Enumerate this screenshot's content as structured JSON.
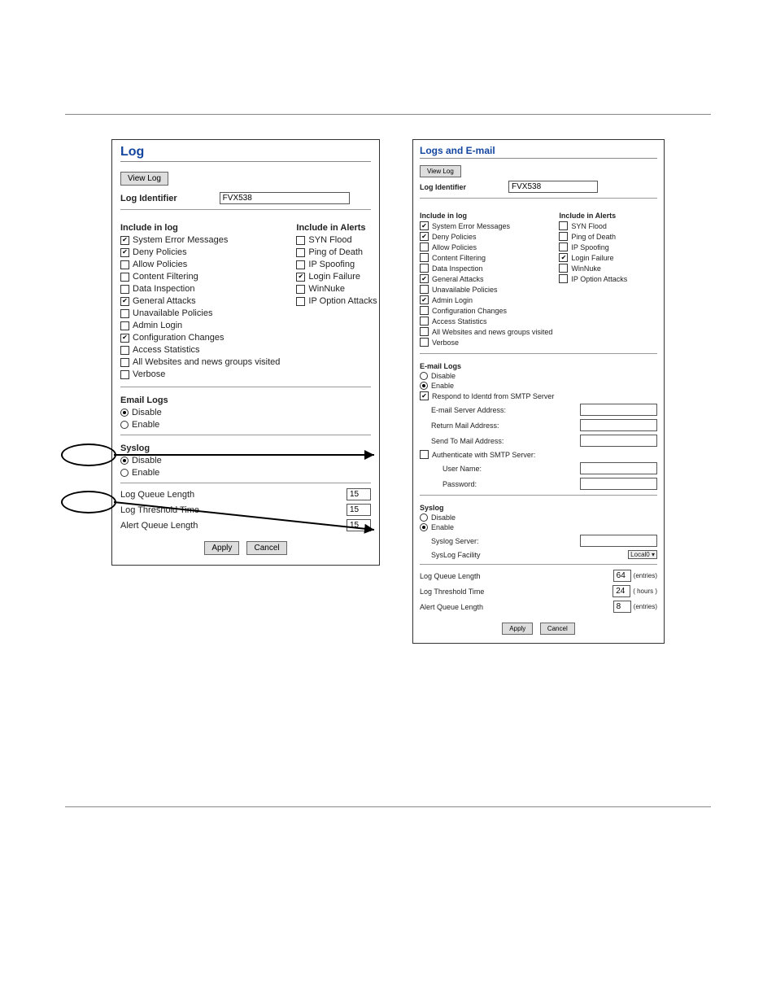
{
  "left": {
    "title": "Log",
    "view_log": "View Log",
    "log_identifier_label": "Log Identifier",
    "log_identifier_value": "FVX538",
    "include_log_hdr": "Include in log",
    "include_alerts_hdr": "Include in Alerts",
    "log_items": [
      {
        "label": "System Error Messages",
        "checked": true
      },
      {
        "label": "Deny Policies",
        "checked": true
      },
      {
        "label": "Allow Policies",
        "checked": false
      },
      {
        "label": "Content Filtering",
        "checked": false
      },
      {
        "label": "Data Inspection",
        "checked": false
      },
      {
        "label": "General Attacks",
        "checked": true
      },
      {
        "label": "Unavailable Policies",
        "checked": false
      },
      {
        "label": "Admin Login",
        "checked": false
      },
      {
        "label": "Configuration Changes",
        "checked": true
      },
      {
        "label": "Access Statistics",
        "checked": false
      },
      {
        "label": "All Websites and news groups visited",
        "checked": false
      },
      {
        "label": "Verbose",
        "checked": false
      }
    ],
    "alert_items": [
      {
        "label": "SYN Flood",
        "checked": false
      },
      {
        "label": "Ping of Death",
        "checked": false
      },
      {
        "label": "IP Spoofing",
        "checked": false
      },
      {
        "label": "Login Failure",
        "checked": true
      },
      {
        "label": "WinNuke",
        "checked": false
      },
      {
        "label": "IP Option Attacks",
        "checked": false
      }
    ],
    "email_logs_hdr": "Email Logs",
    "disable": "Disable",
    "enable": "Enable",
    "syslog_hdr": "Syslog",
    "lql_label": "Log Queue Length",
    "lql_val": "15",
    "ltt_label": "Log Threshold Time",
    "ltt_val": "15",
    "aql_label": "Alert Queue Length",
    "aql_val": "15",
    "apply": "Apply",
    "cancel": "Cancel"
  },
  "right": {
    "title": "Logs and E-mail",
    "view_log": "View Log",
    "log_identifier_label": "Log Identifier",
    "log_identifier_value": "FVX538",
    "include_log_hdr": "Include in log",
    "include_alerts_hdr": "Include in Alerts",
    "log_items": [
      {
        "label": "System Error Messages",
        "checked": true
      },
      {
        "label": "Deny Policies",
        "checked": true
      },
      {
        "label": "Allow Policies",
        "checked": false
      },
      {
        "label": "Content Filtering",
        "checked": false
      },
      {
        "label": "Data Inspection",
        "checked": false
      },
      {
        "label": "General Attacks",
        "checked": true
      },
      {
        "label": "Unavailable Policies",
        "checked": false
      },
      {
        "label": "Admin Login",
        "checked": true
      },
      {
        "label": "Configuration Changes",
        "checked": false
      },
      {
        "label": "Access Statistics",
        "checked": false
      },
      {
        "label": "All Websites and news groups visited",
        "checked": false
      },
      {
        "label": "Verbose",
        "checked": false
      }
    ],
    "alert_items": [
      {
        "label": "SYN Flood",
        "checked": false
      },
      {
        "label": "Ping of Death",
        "checked": false
      },
      {
        "label": "IP Spoofing",
        "checked": false
      },
      {
        "label": "Login Failure",
        "checked": true
      },
      {
        "label": "WinNuke",
        "checked": false
      },
      {
        "label": "IP Option Attacks",
        "checked": false
      }
    ],
    "email_logs_hdr": "E-mail Logs",
    "disable": "Disable",
    "enable": "Enable",
    "respond_identd": "Respond to Identd from SMTP Server",
    "email_server_addr": "E-mail Server Address:",
    "return_mail_addr": "Return Mail Address:",
    "send_to_mail": "Send To Mail Address:",
    "auth_smtp": "Authenticate with SMTP Server:",
    "user_name": "User Name:",
    "password": "Password:",
    "syslog_hdr": "Syslog",
    "syslog_server": "Syslog Server:",
    "syslog_facility": "SysLog Facility",
    "syslog_facility_val": "Local0",
    "lql_label": "Log Queue Length",
    "lql_val": "64",
    "lql_suffix": "(entries)",
    "ltt_label": "Log Threshold Time",
    "ltt_val": "24",
    "ltt_suffix": "( hours )",
    "aql_label": "Alert Queue Length",
    "aql_val": "8",
    "aql_suffix": "(entries)",
    "apply": "Apply",
    "cancel": "Cancel"
  }
}
